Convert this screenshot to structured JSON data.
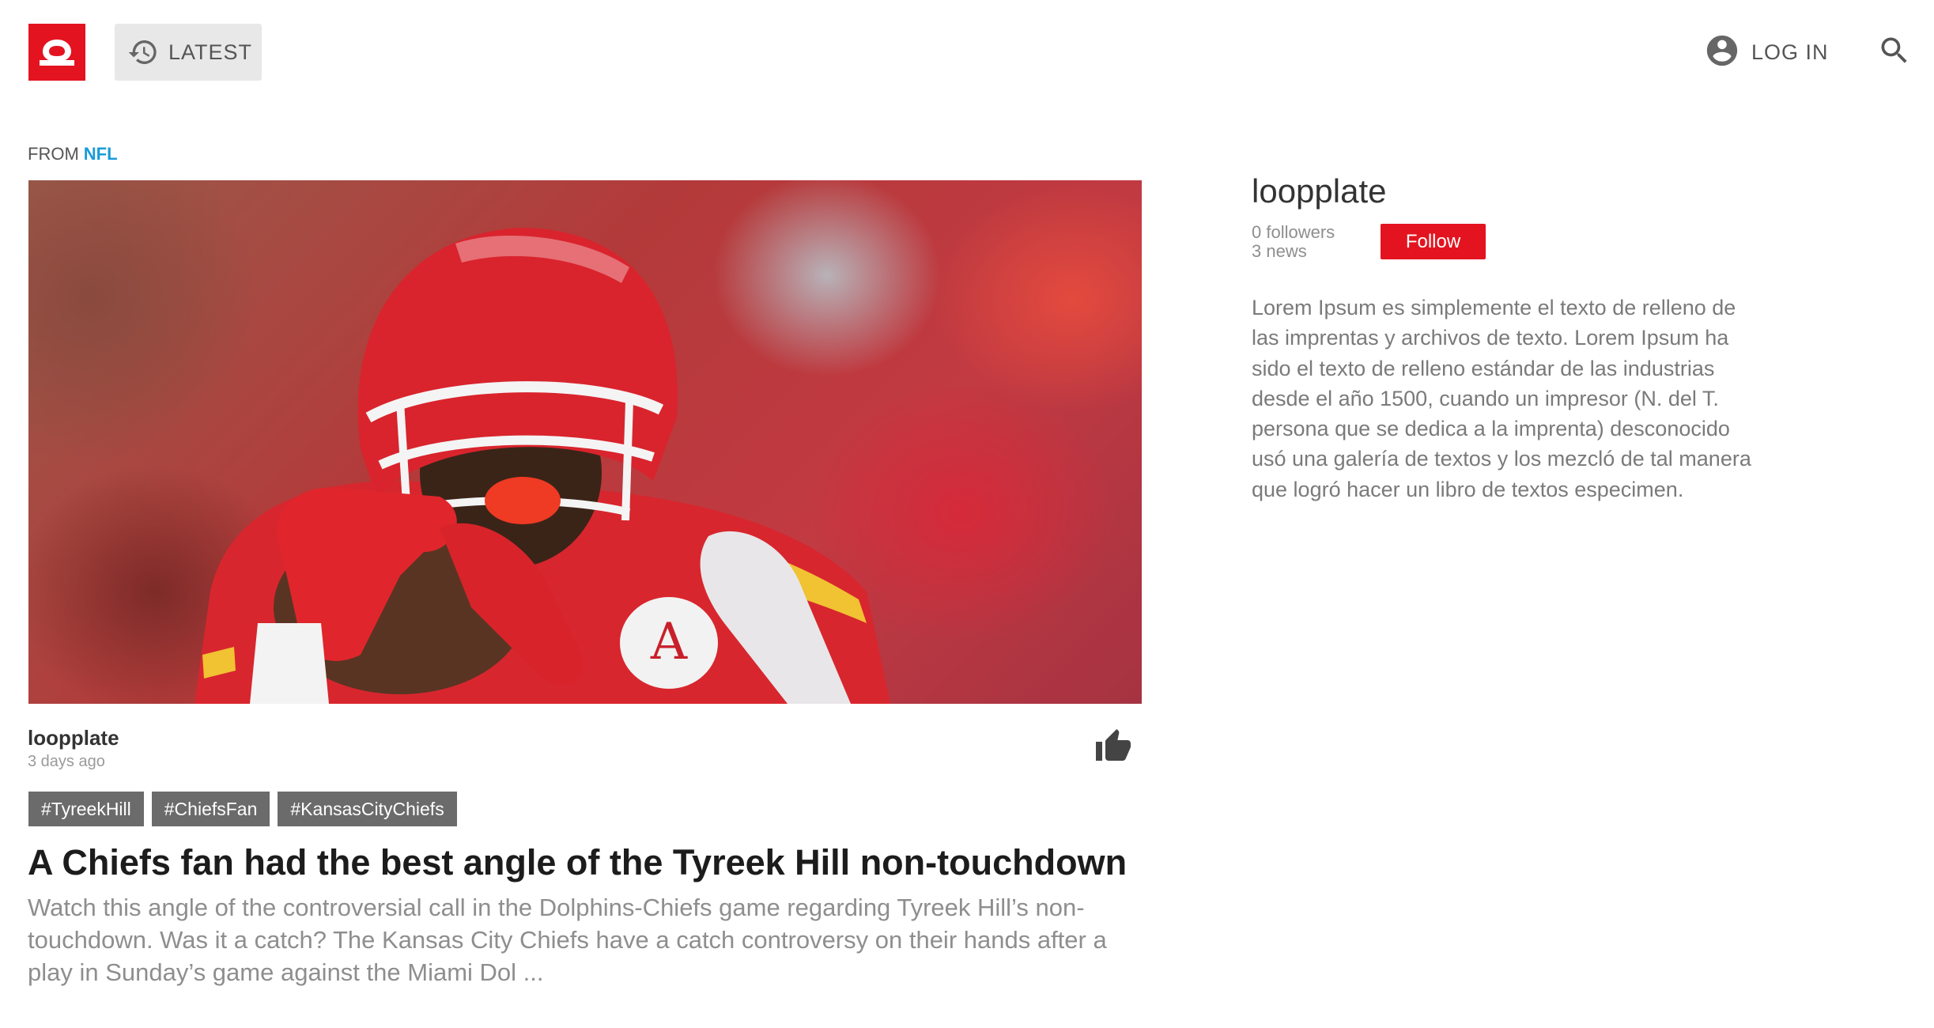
{
  "header": {
    "latest_label": "LATEST",
    "login_label": "LOG IN",
    "brand_color": "#e3141f",
    "icons": [
      "logo-icon",
      "history-icon",
      "account-icon",
      "search-icon"
    ]
  },
  "article": {
    "from_prefix": "FROM",
    "source": "NFL",
    "author": "loopplate",
    "time": "3 days ago",
    "tags": [
      "#TyreekHill",
      "#ChiefsFan",
      "#KansasCityChiefs"
    ],
    "headline": "A Chiefs fan had the best angle of the Tyreek Hill non-touchdown",
    "excerpt": "Watch this angle of the controversial call in the Dolphins-Chiefs game regarding Tyreek Hill’s non-touchdown. Was it a catch? The Kansas City Chiefs have a catch controversy on their hands after a play in Sunday’s game against the Miami Dol ..."
  },
  "sidebar": {
    "name": "loopplate",
    "followers": "0 followers",
    "news": "3 news",
    "follow_label": "Follow",
    "description": "Lorem Ipsum es simplemente el texto de relleno de las imprentas y archivos de texto. Lorem Ipsum ha sido el texto de relleno estándar de las industrias desde el año 1500, cuando un impresor (N. del T. persona que se dedica a la imprenta) desconocido usó una galería de textos y los mezcló de tal manera que logró hacer un libro de textos especimen."
  }
}
